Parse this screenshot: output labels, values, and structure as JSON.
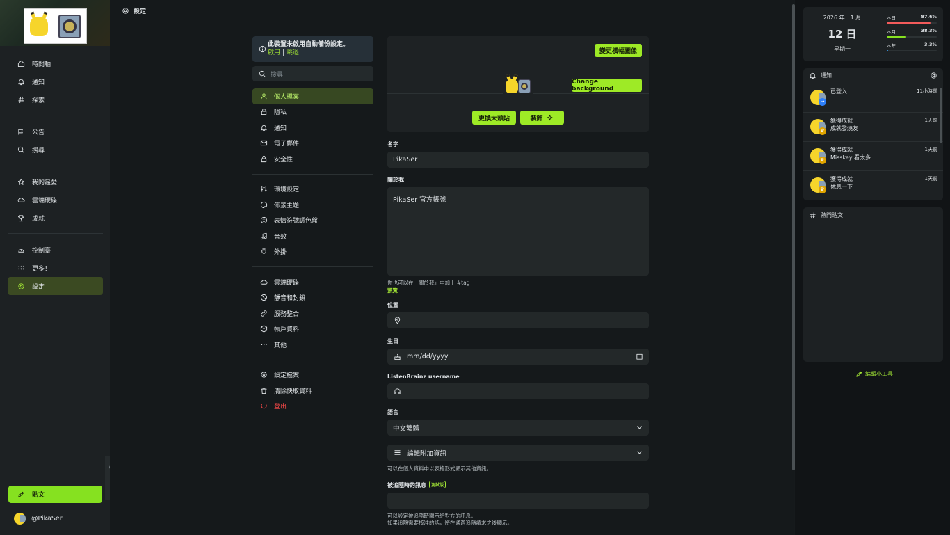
{
  "header": {
    "title": "設定"
  },
  "nav": {
    "items": [
      {
        "label": "時間軸",
        "icon": "home-icon"
      },
      {
        "label": "通知",
        "icon": "bell-icon"
      },
      {
        "label": "探索",
        "icon": "hash-icon"
      },
      {
        "label": "公告",
        "icon": "megaphone-icon"
      },
      {
        "label": "搜尋",
        "icon": "search-icon"
      },
      {
        "label": "我的最愛",
        "icon": "star-icon"
      },
      {
        "label": "雲端硬碟",
        "icon": "cloud-icon"
      },
      {
        "label": "成就",
        "icon": "trophy-icon"
      },
      {
        "label": "控制臺",
        "icon": "gauge-icon"
      },
      {
        "label": "更多！",
        "icon": "grid-dots-icon"
      },
      {
        "label": "設定",
        "icon": "gear-icon"
      }
    ],
    "post_label": "貼文",
    "username": "@PikaSer"
  },
  "notice": {
    "text": "此裝置未啟用自動備份設定。",
    "enable": "啟用",
    "separator": "|",
    "skip": "跳過"
  },
  "settings_menu": {
    "search_placeholder": "搜尋",
    "group1": [
      "個人檔案",
      "隱私",
      "通知",
      "電子郵件",
      "安全性"
    ],
    "group2": [
      "環境設定",
      "佈景主題",
      "表情符號調色盤",
      "音效",
      "外掛"
    ],
    "group3": [
      "雲端硬碟",
      "靜音和封鎖",
      "服務整合",
      "帳戶資料",
      "其他"
    ],
    "group4": [
      "設定檔案",
      "清除快取資料",
      "登出"
    ]
  },
  "profile": {
    "change_banner": "變更橫幅圖像",
    "change_background": "Change background",
    "change_avatar": "更換大頭貼",
    "decorate": "裝飾",
    "name_label": "名字",
    "name_value": "PikaSer",
    "about_label": "關於我",
    "about_value": "PikaSer 官方帳號",
    "about_hint": "你也可以在「關於我」中加上 #tag",
    "preview": "預覽",
    "location_label": "位置",
    "birthday_label": "生日",
    "birthday_placeholder": "mm/dd/yyyy",
    "listenbrainz_label": "ListenBrainz username",
    "language_label": "語言",
    "language_value": "中文繁體",
    "extra_label": "編輯附加資訊",
    "extra_hint": "可以在個人資料中以表格形式顯示其他資訊。",
    "follow_msg_label": "被追隨時的訊息",
    "beta_badge": "測試版",
    "follow_hint1": "可以設定被追隨時顯示給對方的訊息。",
    "follow_hint2": "如果追隨需要核准的話，將在通過追隨請求之後顯示。"
  },
  "calendar": {
    "year_month": "2026 年　1 月",
    "day": "12 日",
    "weekday": "星期一",
    "stats": [
      {
        "label": "本日",
        "value": "87.6%",
        "fraction": 0.876,
        "color": "#f35b5b"
      },
      {
        "label": "本月",
        "value": "38.3%",
        "fraction": 0.383,
        "color": "#86e120"
      },
      {
        "label": "本年",
        "value": "3.3%",
        "fraction": 0.033,
        "color": "#3aa7ff"
      }
    ]
  },
  "notifications": {
    "title": "通知",
    "items": [
      {
        "title": "已登入",
        "sub": "",
        "time": "11小時前",
        "badge_color": "#2d7ff9",
        "badge": "→"
      },
      {
        "title": "獲得成就",
        "sub": "成就發燒友",
        "time": "1天前",
        "badge_color": "#e0a400",
        "badge": "♛"
      },
      {
        "title": "獲得成就",
        "sub": "Misskey 看太多",
        "time": "1天前",
        "badge_color": "#e0a400",
        "badge": "♛"
      },
      {
        "title": "獲得成就",
        "sub": "休息一下",
        "time": "1天前",
        "badge_color": "#e0a400",
        "badge": "♛"
      }
    ]
  },
  "trending": {
    "title": "熱門貼文"
  },
  "edit_widgets": "編輯小工具",
  "colors": {
    "accent": "#86e120",
    "danger": "#ff4a4a"
  }
}
